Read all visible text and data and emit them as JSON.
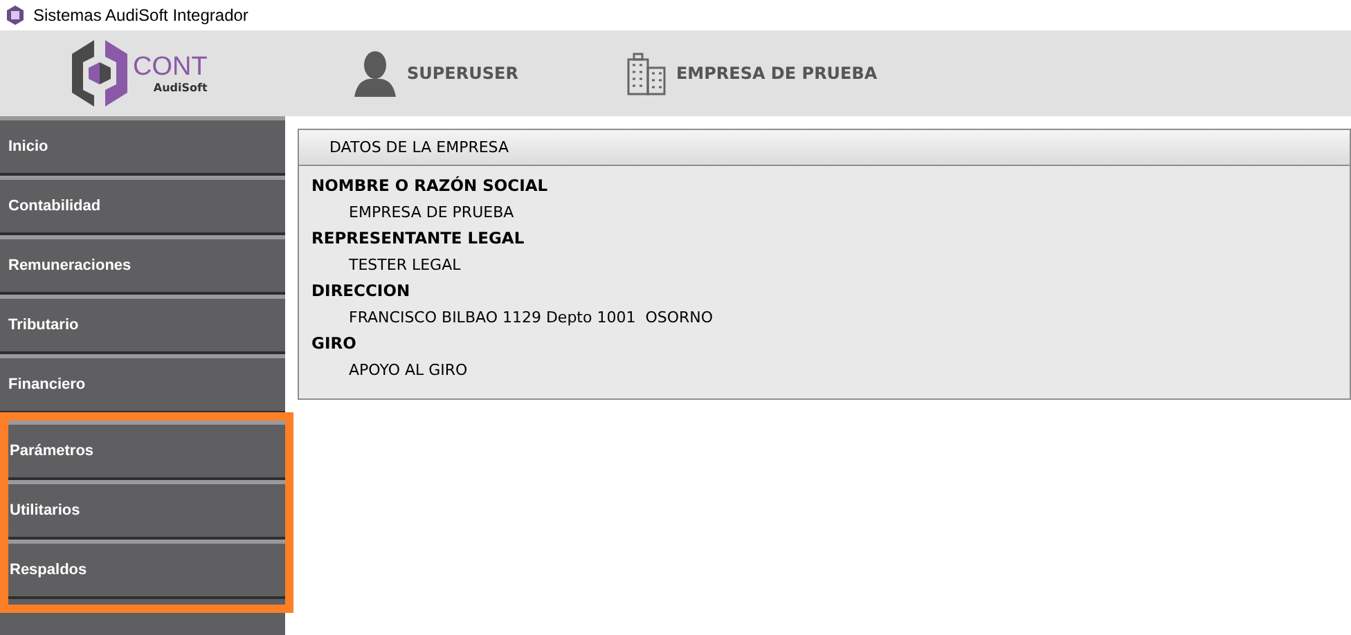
{
  "window": {
    "title": "Sistemas AudiSoft Integrador"
  },
  "header": {
    "logo": {
      "main": "CONT",
      "sub": "AudiSoft"
    },
    "user": "SUPERUSER",
    "company": "EMPRESA DE PRUEBA"
  },
  "sidebar": {
    "items": [
      {
        "label": "Inicio",
        "highlighted": false
      },
      {
        "label": "Contabilidad",
        "highlighted": false
      },
      {
        "label": "Remuneraciones",
        "highlighted": false
      },
      {
        "label": "Tributario",
        "highlighted": false
      },
      {
        "label": "Financiero",
        "highlighted": false
      },
      {
        "label": "Parámetros",
        "highlighted": true
      },
      {
        "label": "Utilitarios",
        "highlighted": true
      },
      {
        "label": "Respaldos",
        "highlighted": true
      }
    ]
  },
  "panel": {
    "title": "DATOS DE LA EMPRESA",
    "fields": [
      {
        "label": "NOMBRE O RAZÓN SOCIAL",
        "value": "EMPRESA DE PRUEBA"
      },
      {
        "label": "REPRESENTANTE LEGAL",
        "value": "TESTER LEGAL"
      },
      {
        "label": "DIRECCION",
        "value": "FRANCISCO BILBAO 1129 Depto 1001  OSORNO"
      },
      {
        "label": "GIRO",
        "value": "APOYO AL GIRO"
      }
    ]
  }
}
